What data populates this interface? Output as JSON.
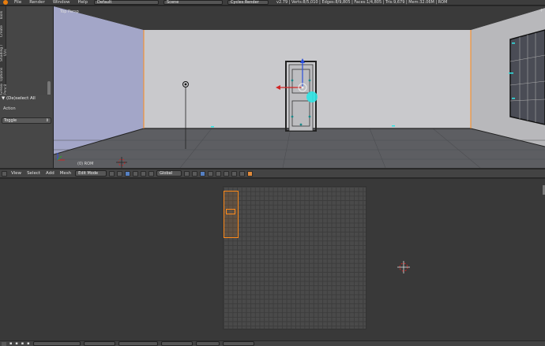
{
  "topbar": {
    "menus": [
      "File",
      "Render",
      "Window",
      "Help"
    ],
    "layout_value": "Default",
    "scene_value": "Scene",
    "engine_value": "Cycles Render",
    "stats": "v2.79 | Verts:8/5,010 | Edges:8/9,805 | Faces:1/4,805 | Tris:9,679 | Mem:32.06M | ROM"
  },
  "shelf": {
    "tabs": [
      "Tools",
      "Create",
      "Shading / UVs",
      "Options",
      "Grease Pencil"
    ],
    "operator_title": "(De)select All",
    "action_label": "Action",
    "action_value": "Toggle"
  },
  "viewport": {
    "view_label": "Top Persp",
    "object_label": "(0) ROM"
  },
  "view_header": {
    "menus": [
      "View",
      "Select",
      "Add",
      "Mesh"
    ],
    "mode_value": "Edit Mode",
    "orientation_value": "Global"
  },
  "colors": {
    "selected": "#ff8a1a",
    "lamp": "#2ee6e6",
    "axis_x": "#d12525",
    "axis_y": "#2fa02f",
    "axis_z": "#2b4fdc"
  }
}
